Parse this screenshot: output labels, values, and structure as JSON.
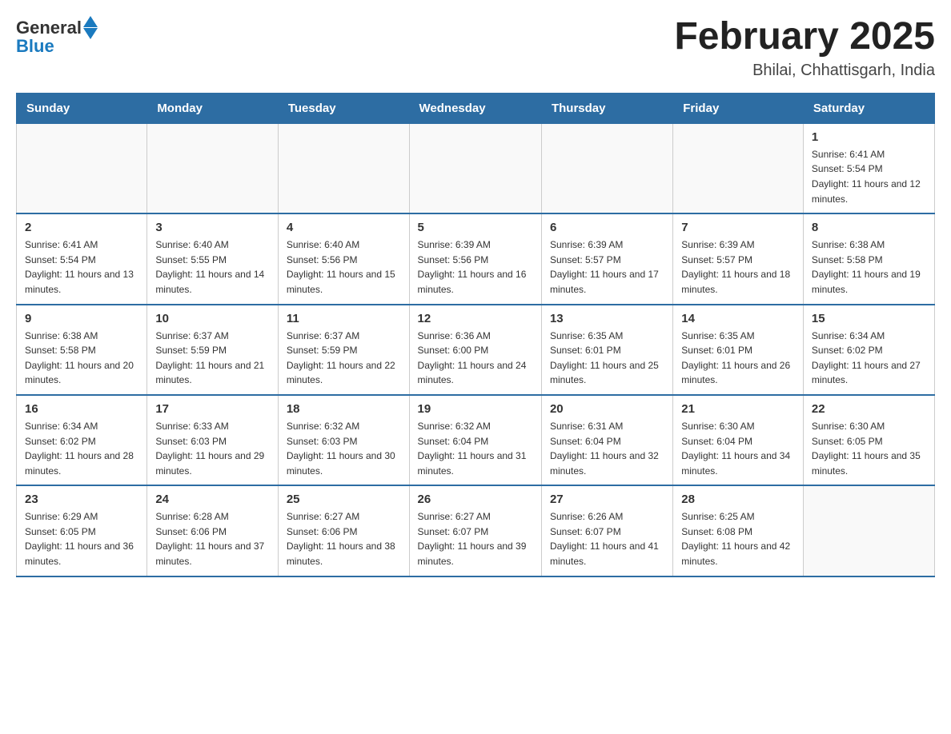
{
  "logo": {
    "general": "General",
    "blue": "Blue"
  },
  "title": "February 2025",
  "location": "Bhilai, Chhattisgarh, India",
  "days_of_week": [
    "Sunday",
    "Monday",
    "Tuesday",
    "Wednesday",
    "Thursday",
    "Friday",
    "Saturday"
  ],
  "weeks": [
    [
      {
        "day": "",
        "sunrise": "",
        "sunset": "",
        "daylight": ""
      },
      {
        "day": "",
        "sunrise": "",
        "sunset": "",
        "daylight": ""
      },
      {
        "day": "",
        "sunrise": "",
        "sunset": "",
        "daylight": ""
      },
      {
        "day": "",
        "sunrise": "",
        "sunset": "",
        "daylight": ""
      },
      {
        "day": "",
        "sunrise": "",
        "sunset": "",
        "daylight": ""
      },
      {
        "day": "",
        "sunrise": "",
        "sunset": "",
        "daylight": ""
      },
      {
        "day": "1",
        "sunrise": "Sunrise: 6:41 AM",
        "sunset": "Sunset: 5:54 PM",
        "daylight": "Daylight: 11 hours and 12 minutes."
      }
    ],
    [
      {
        "day": "2",
        "sunrise": "Sunrise: 6:41 AM",
        "sunset": "Sunset: 5:54 PM",
        "daylight": "Daylight: 11 hours and 13 minutes."
      },
      {
        "day": "3",
        "sunrise": "Sunrise: 6:40 AM",
        "sunset": "Sunset: 5:55 PM",
        "daylight": "Daylight: 11 hours and 14 minutes."
      },
      {
        "day": "4",
        "sunrise": "Sunrise: 6:40 AM",
        "sunset": "Sunset: 5:56 PM",
        "daylight": "Daylight: 11 hours and 15 minutes."
      },
      {
        "day": "5",
        "sunrise": "Sunrise: 6:39 AM",
        "sunset": "Sunset: 5:56 PM",
        "daylight": "Daylight: 11 hours and 16 minutes."
      },
      {
        "day": "6",
        "sunrise": "Sunrise: 6:39 AM",
        "sunset": "Sunset: 5:57 PM",
        "daylight": "Daylight: 11 hours and 17 minutes."
      },
      {
        "day": "7",
        "sunrise": "Sunrise: 6:39 AM",
        "sunset": "Sunset: 5:57 PM",
        "daylight": "Daylight: 11 hours and 18 minutes."
      },
      {
        "day": "8",
        "sunrise": "Sunrise: 6:38 AM",
        "sunset": "Sunset: 5:58 PM",
        "daylight": "Daylight: 11 hours and 19 minutes."
      }
    ],
    [
      {
        "day": "9",
        "sunrise": "Sunrise: 6:38 AM",
        "sunset": "Sunset: 5:58 PM",
        "daylight": "Daylight: 11 hours and 20 minutes."
      },
      {
        "day": "10",
        "sunrise": "Sunrise: 6:37 AM",
        "sunset": "Sunset: 5:59 PM",
        "daylight": "Daylight: 11 hours and 21 minutes."
      },
      {
        "day": "11",
        "sunrise": "Sunrise: 6:37 AM",
        "sunset": "Sunset: 5:59 PM",
        "daylight": "Daylight: 11 hours and 22 minutes."
      },
      {
        "day": "12",
        "sunrise": "Sunrise: 6:36 AM",
        "sunset": "Sunset: 6:00 PM",
        "daylight": "Daylight: 11 hours and 24 minutes."
      },
      {
        "day": "13",
        "sunrise": "Sunrise: 6:35 AM",
        "sunset": "Sunset: 6:01 PM",
        "daylight": "Daylight: 11 hours and 25 minutes."
      },
      {
        "day": "14",
        "sunrise": "Sunrise: 6:35 AM",
        "sunset": "Sunset: 6:01 PM",
        "daylight": "Daylight: 11 hours and 26 minutes."
      },
      {
        "day": "15",
        "sunrise": "Sunrise: 6:34 AM",
        "sunset": "Sunset: 6:02 PM",
        "daylight": "Daylight: 11 hours and 27 minutes."
      }
    ],
    [
      {
        "day": "16",
        "sunrise": "Sunrise: 6:34 AM",
        "sunset": "Sunset: 6:02 PM",
        "daylight": "Daylight: 11 hours and 28 minutes."
      },
      {
        "day": "17",
        "sunrise": "Sunrise: 6:33 AM",
        "sunset": "Sunset: 6:03 PM",
        "daylight": "Daylight: 11 hours and 29 minutes."
      },
      {
        "day": "18",
        "sunrise": "Sunrise: 6:32 AM",
        "sunset": "Sunset: 6:03 PM",
        "daylight": "Daylight: 11 hours and 30 minutes."
      },
      {
        "day": "19",
        "sunrise": "Sunrise: 6:32 AM",
        "sunset": "Sunset: 6:04 PM",
        "daylight": "Daylight: 11 hours and 31 minutes."
      },
      {
        "day": "20",
        "sunrise": "Sunrise: 6:31 AM",
        "sunset": "Sunset: 6:04 PM",
        "daylight": "Daylight: 11 hours and 32 minutes."
      },
      {
        "day": "21",
        "sunrise": "Sunrise: 6:30 AM",
        "sunset": "Sunset: 6:04 PM",
        "daylight": "Daylight: 11 hours and 34 minutes."
      },
      {
        "day": "22",
        "sunrise": "Sunrise: 6:30 AM",
        "sunset": "Sunset: 6:05 PM",
        "daylight": "Daylight: 11 hours and 35 minutes."
      }
    ],
    [
      {
        "day": "23",
        "sunrise": "Sunrise: 6:29 AM",
        "sunset": "Sunset: 6:05 PM",
        "daylight": "Daylight: 11 hours and 36 minutes."
      },
      {
        "day": "24",
        "sunrise": "Sunrise: 6:28 AM",
        "sunset": "Sunset: 6:06 PM",
        "daylight": "Daylight: 11 hours and 37 minutes."
      },
      {
        "day": "25",
        "sunrise": "Sunrise: 6:27 AM",
        "sunset": "Sunset: 6:06 PM",
        "daylight": "Daylight: 11 hours and 38 minutes."
      },
      {
        "day": "26",
        "sunrise": "Sunrise: 6:27 AM",
        "sunset": "Sunset: 6:07 PM",
        "daylight": "Daylight: 11 hours and 39 minutes."
      },
      {
        "day": "27",
        "sunrise": "Sunrise: 6:26 AM",
        "sunset": "Sunset: 6:07 PM",
        "daylight": "Daylight: 11 hours and 41 minutes."
      },
      {
        "day": "28",
        "sunrise": "Sunrise: 6:25 AM",
        "sunset": "Sunset: 6:08 PM",
        "daylight": "Daylight: 11 hours and 42 minutes."
      },
      {
        "day": "",
        "sunrise": "",
        "sunset": "",
        "daylight": ""
      }
    ]
  ]
}
